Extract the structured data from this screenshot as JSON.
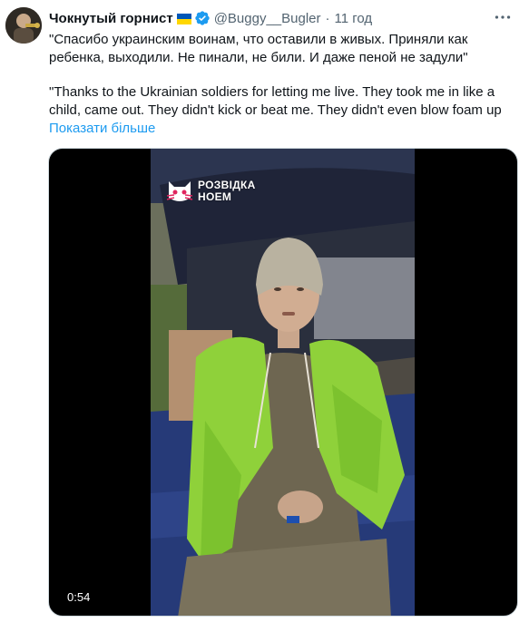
{
  "tweet": {
    "display_name": "Чокнутый горнист",
    "handle": "@Buggy__Bugler",
    "separator": "·",
    "time": "11 год",
    "text_ru": "\"Спасибо украинским воинам, что оставили в живых. Приняли как ребенка, выходили. Не пинали, не били. И даже пеной не задули\"",
    "text_en": "\"Thanks to the Ukrainian soldiers for letting me live. They took me in like a child, came out. They didn't kick or beat me. They didn't even blow foam up",
    "show_more": "Показати більше"
  },
  "media": {
    "watermark_line1": "РОЗВІДКА",
    "watermark_line2": "НОЕМ",
    "duration": "0:54"
  },
  "colors": {
    "text": "#0f1419",
    "secondary": "#536471",
    "link": "#1d9bf0",
    "verified": "#1d9bf0",
    "flag_blue": "#0057b7",
    "flag_yellow": "#ffd700",
    "jacket_green": "#8fd13a"
  },
  "icons": {
    "verified": "verified-badge-icon",
    "flag": "ukraine-flag-icon",
    "more": "more-dots-icon",
    "watermark": "cat-logo-icon"
  }
}
